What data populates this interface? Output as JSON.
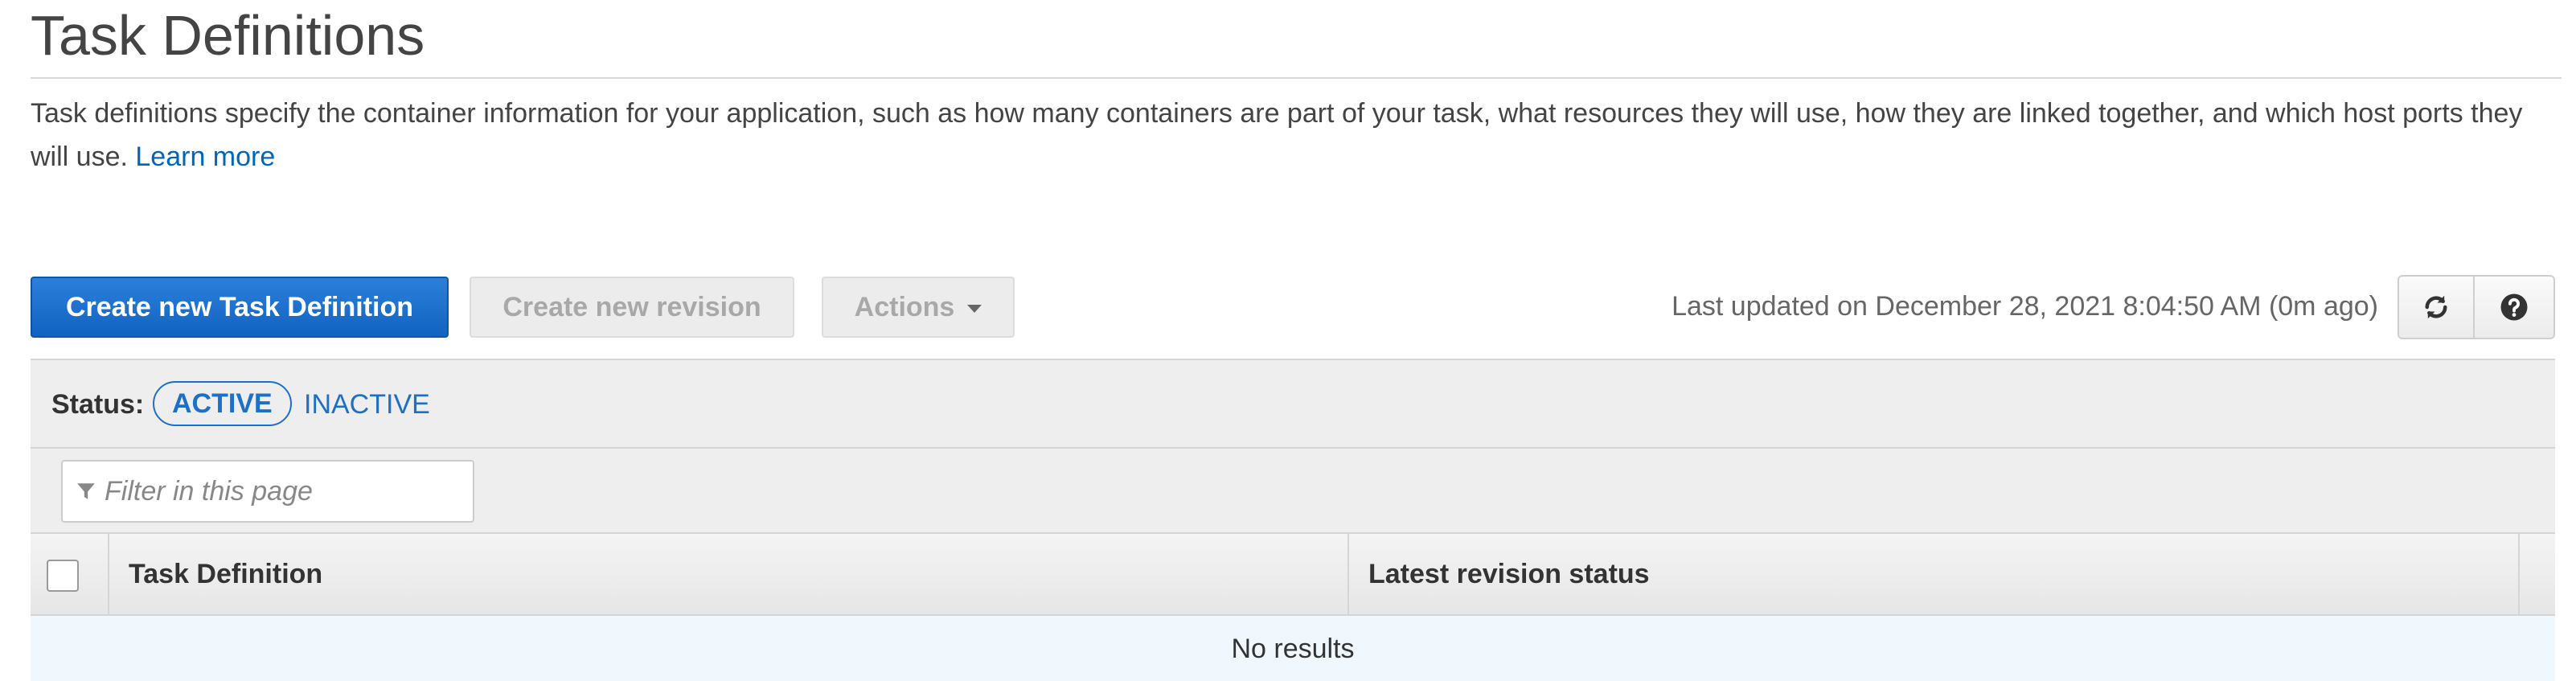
{
  "page": {
    "title": "Task Definitions",
    "description": "Task definitions specify the container information for your application, such as how many containers are part of your task, what resources they will use, how they are linked together, and which host ports they will use.",
    "learn_more": "Learn more"
  },
  "toolbar": {
    "create_label": "Create new Task Definition",
    "revision_label": "Create new revision",
    "actions_label": "Actions",
    "last_updated": "Last updated on December 28, 2021 8:04:50 AM (0m ago)",
    "refresh_icon": "refresh-icon",
    "help_icon": "help-icon"
  },
  "status_filter": {
    "label": "Status:",
    "options": [
      "ACTIVE",
      "INACTIVE"
    ],
    "selected": "ACTIVE"
  },
  "filter": {
    "placeholder": "Filter in this page",
    "value": "",
    "icon": "filter-icon"
  },
  "table": {
    "columns": [
      "Task Definition",
      "Latest revision status"
    ],
    "empty_message": "No results"
  },
  "colors": {
    "primary": "#1263c1",
    "link": "#0066bb",
    "empty_row": "#f0f8fd"
  }
}
